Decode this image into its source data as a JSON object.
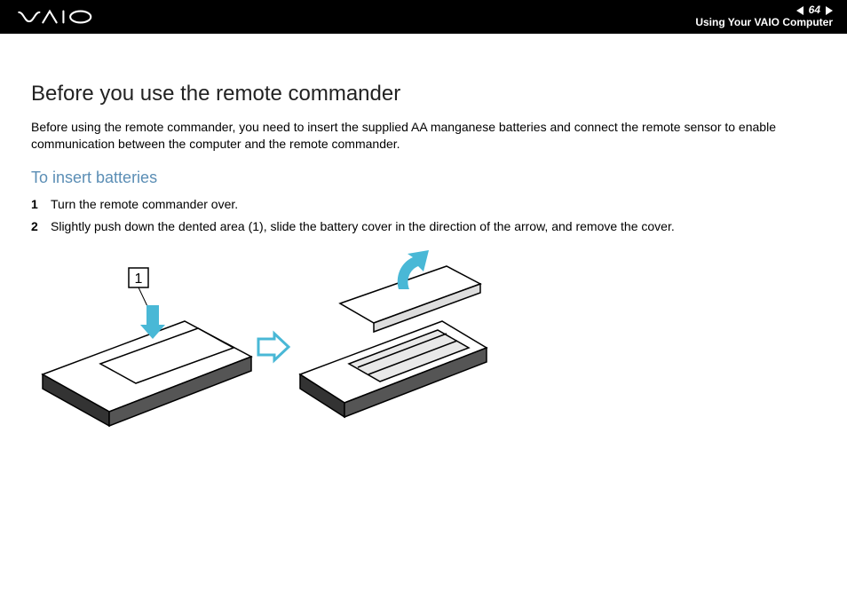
{
  "header": {
    "page_number": "64",
    "section": "Using Your VAIO Computer"
  },
  "content": {
    "title": "Before you use the remote commander",
    "intro": "Before using the remote commander, you need to insert the supplied AA manganese batteries and connect the remote sensor to enable communication between the computer and the remote commander.",
    "subtitle": "To insert batteries",
    "steps": [
      "Turn the remote commander over.",
      "Slightly push down the dented area (1), slide the battery cover in the direction of the arrow, and remove the cover."
    ],
    "figure_callout": "1"
  }
}
